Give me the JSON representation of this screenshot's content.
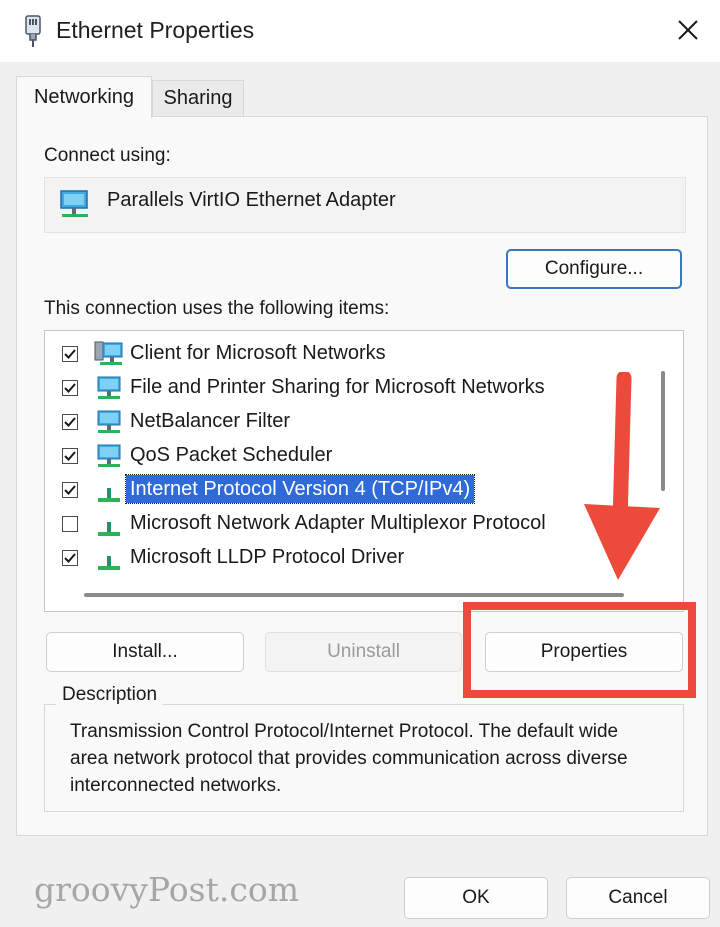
{
  "window": {
    "title": "Ethernet Properties",
    "icon": "ethernet-icon",
    "close_icon": "close-icon"
  },
  "tabs": [
    {
      "label": "Networking",
      "active": true
    },
    {
      "label": "Sharing",
      "active": false
    }
  ],
  "connect_using": {
    "label": "Connect using:",
    "adapter_name": "Parallels VirtIO Ethernet Adapter",
    "adapter_icon": "network-adapter-icon",
    "configure_label": "Configure..."
  },
  "items_section": {
    "label": "This connection uses the following items:",
    "items": [
      {
        "label": "Client for Microsoft Networks",
        "checked": true,
        "icon": "network-client-icon",
        "selected": false
      },
      {
        "label": "File and Printer Sharing for Microsoft Networks",
        "checked": true,
        "icon": "network-service-icon",
        "selected": false
      },
      {
        "label": "NetBalancer Filter",
        "checked": true,
        "icon": "network-service-icon",
        "selected": false
      },
      {
        "label": "QoS Packet Scheduler",
        "checked": true,
        "icon": "network-service-icon",
        "selected": false
      },
      {
        "label": "Internet Protocol Version 4 (TCP/IPv4)",
        "checked": true,
        "icon": "protocol-icon",
        "selected": true
      },
      {
        "label": "Microsoft Network Adapter Multiplexor Protocol",
        "checked": false,
        "icon": "protocol-icon",
        "selected": false
      },
      {
        "label": "Microsoft LLDP Protocol Driver",
        "checked": true,
        "icon": "protocol-icon",
        "selected": false
      }
    ]
  },
  "buttons": {
    "install": "Install...",
    "uninstall": "Uninstall",
    "properties": "Properties",
    "ok": "OK",
    "cancel": "Cancel"
  },
  "description": {
    "legend": "Description",
    "text": "Transmission Control Protocol/Internet Protocol. The default wide area network protocol that provides communication across diverse interconnected networks."
  },
  "watermark": "groovyPost.com",
  "colors": {
    "selection": "#2f6ad9",
    "annotation": "#ec4b3c",
    "configure_focus": "#3b76c4"
  }
}
